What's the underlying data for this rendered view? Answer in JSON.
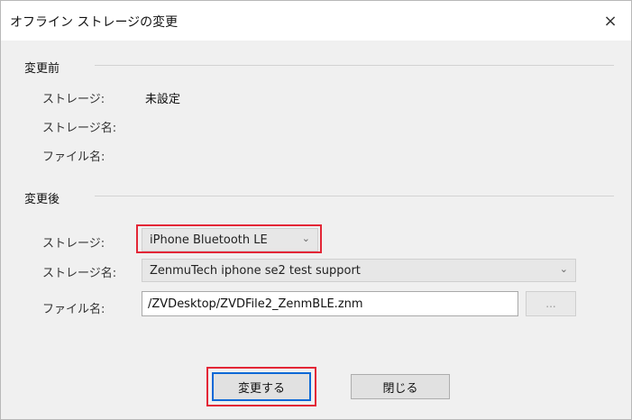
{
  "window": {
    "title": "オフライン ストレージの変更",
    "close_glyph": "×"
  },
  "before": {
    "group_title": "変更前",
    "storage_label": "ストレージ:",
    "storage_value": "未設定",
    "storage_name_label": "ストレージ名:",
    "file_name_label": "ファイル名:"
  },
  "after": {
    "group_title": "変更後",
    "storage_label": "ストレージ:",
    "storage_value": "iPhone Bluetooth LE",
    "storage_name_label": "ストレージ名:",
    "storage_name_value": "ZenmuTech iphone se2 test support",
    "file_name_label": "ファイル名:",
    "file_name_value": "/ZVDesktop/ZVDFile2_ZenmBLE.znm",
    "browse_label": "..."
  },
  "buttons": {
    "change_label": "変更する",
    "close_label": "閉じる"
  },
  "icons": {
    "dropdown_chevron": "chevron-down-icon",
    "close": "close-icon"
  },
  "colors": {
    "highlight_red": "#e32636",
    "focus_blue": "#0b68d6"
  }
}
